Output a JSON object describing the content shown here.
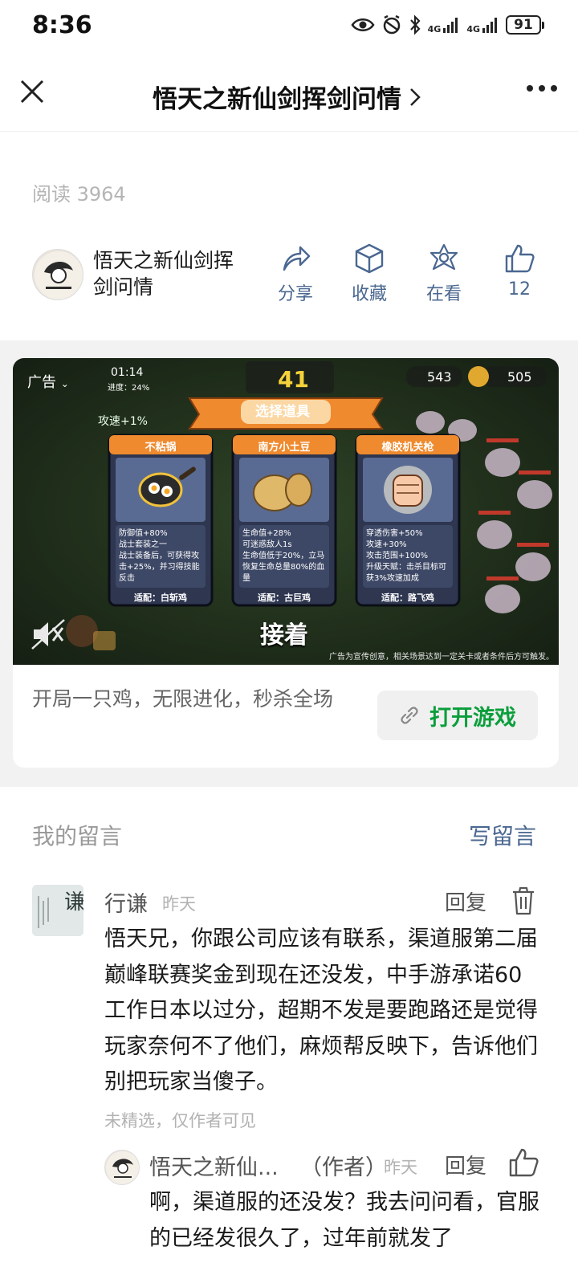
{
  "status_bar": {
    "time": "8:36",
    "network_1": "4G",
    "network_2": "4G",
    "battery": "91",
    "icons": [
      "eye-icon",
      "alarm-icon",
      "bluetooth-icon",
      "signal-icon",
      "signal-icon",
      "battery-icon"
    ]
  },
  "nav": {
    "title": "悟天之新仙剑挥剑问情",
    "close_icon": "close-icon",
    "more_icon": "more-icon"
  },
  "article": {
    "read_count": "阅读 3964"
  },
  "author": {
    "name": "悟天之新仙剑挥剑问情",
    "actions": [
      {
        "label": "分享",
        "icon": "share-icon"
      },
      {
        "label": "收藏",
        "icon": "cube-icon"
      },
      {
        "label": "在看",
        "icon": "star-icon"
      },
      {
        "label": "12",
        "icon": "thumbs-up-icon"
      }
    ]
  },
  "ad": {
    "badge": "广告",
    "hud": {
      "time": "01:14",
      "progress": "进度：24%",
      "score": "41",
      "count_1": "543",
      "count_2": "505"
    },
    "buff": "攻速+1%",
    "banner": "选择道具",
    "choices": [
      {
        "title": "不粘锅",
        "stats": [
          "防御值+80%",
          "战士套装之一",
          "战士装备后，可获得攻击+25%，并习得技能反击"
        ],
        "fit": "适配：白斩鸡"
      },
      {
        "title": "南方小土豆",
        "stats": [
          "生命值+28%",
          "可迷惑敌人1s",
          "生命值低于20%，立马恢复生命总量80%的血量"
        ],
        "fit": "适配：古巨鸡"
      },
      {
        "title": "橡胶机关枪",
        "stats": [
          "穿透伤害+50%",
          "攻速+30%",
          "攻击范围+100%",
          "升级天赋：击杀目标可获3%攻速加成"
        ],
        "fit": "适配：路飞鸡"
      }
    ],
    "continue": "接着",
    "footnote": "广告为宣传创意，相关场景达到一定关卡或者条件后方可触发。",
    "description": "开局一只鸡，无限进化，秒杀全场",
    "open_button": "打开游戏",
    "accent": "#0b9e3b"
  },
  "comments": {
    "header": "我的留言",
    "write": "写留言",
    "items": [
      {
        "name": "行谦",
        "time": "昨天",
        "reply": "回复",
        "text": "悟天兄，你跟公司应该有联系，渠道服第二届巅峰联赛奖金到现在还没发，中手游承诺60工作日本以过分，超期不发是要跑路还是觉得玩家奈何不了他们，麻烦帮反映下，告诉他们别把玩家当傻子。",
        "note": "未精选，仅作者可见",
        "reply_item": {
          "name": "悟天之新仙...",
          "tag": "（作者）",
          "time": "昨天",
          "reply": "回复",
          "text": "啊，渠道服的还没发？我去问问看，官服的已经发很久了，过年前就发了"
        }
      }
    ]
  },
  "colors": {
    "link_blue": "#4a6790",
    "muted": "#b2b2b2",
    "section_bg": "#f2f2f2"
  }
}
